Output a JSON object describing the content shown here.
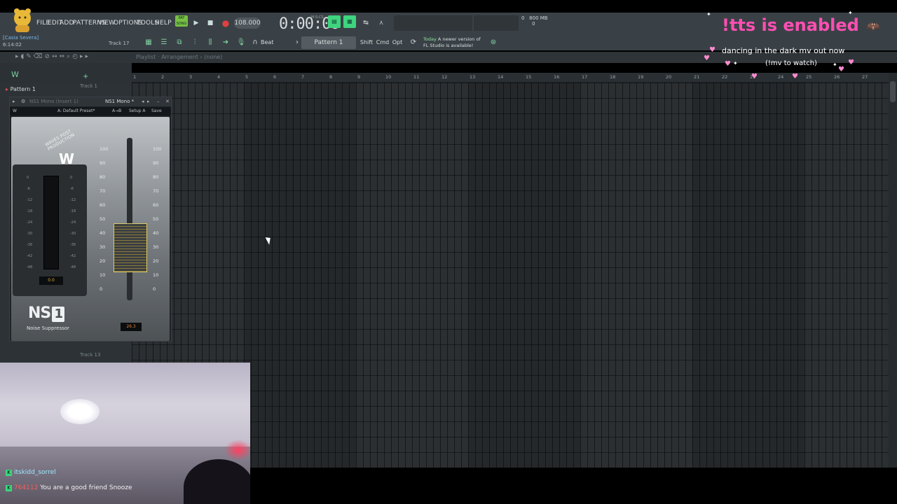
{
  "menu": [
    "FILE",
    "EDIT",
    "ADD",
    "PATTERNS",
    "VIEW",
    "OPTIONS",
    "TOOLS",
    "HELP"
  ],
  "project": {
    "name": "[Casia Severa]",
    "time": "6:14:02",
    "track": "Track 17"
  },
  "transport": {
    "pattern_badge": "PAT SONG",
    "play": "▶",
    "stop": "■",
    "record": "●",
    "tempo": "108.000",
    "time": "0:00:00",
    "time_unit": "M:S:CS"
  },
  "monitor": {
    "cpu": "0",
    "memory": "800 MB",
    "polyphony": "0"
  },
  "toolbar2": {
    "snap": "Beat",
    "pattern": "Pattern 1",
    "keys": [
      "Shift",
      "Cmd",
      "Opt"
    ],
    "news_line1_prefix": "Today",
    "news_line1": "A newer version of",
    "news_line2": "FL Studio is available!"
  },
  "playlist": {
    "title": "Playlist · Arrangement › (none)",
    "pattern_label": "Pattern 1",
    "tracks": [
      "Track 1",
      "Track 13"
    ],
    "bars": [
      "1",
      "2",
      "3",
      "4",
      "5",
      "6",
      "7",
      "8",
      "9",
      "10",
      "11",
      "12",
      "13",
      "14",
      "15",
      "16",
      "17",
      "18",
      "19",
      "20",
      "21",
      "22",
      "23",
      "24",
      "25",
      "26",
      "27"
    ]
  },
  "plugin": {
    "title": "NS1 Mono (Insert 1)",
    "title_right": "NS1 Mono *",
    "preset": "A: Default Preset*",
    "btn_ab": "A→B",
    "btn_setup": "Setup A",
    "btn_save": "Save",
    "brand": "WAVES POST PRODUCTION",
    "product": "NS",
    "product_num": "1",
    "product_sub": "Noise Suppressor",
    "meter_value": "0.0",
    "fader_value": "26.3",
    "meter_scale": [
      "0",
      "-6",
      "-12",
      "-18",
      "-24",
      "-30",
      "-36",
      "-42",
      "-48"
    ],
    "fader_scale": [
      "100",
      "90",
      "80",
      "70",
      "60",
      "50",
      "40",
      "30",
      "20",
      "10",
      "0"
    ]
  },
  "overlay": {
    "title": "!tts is enabled",
    "line1": "dancing in the dark mv out now",
    "line2": "(!mv to watch)"
  },
  "chat": [
    {
      "user": "itskidd_sorrel",
      "message": ""
    },
    {
      "user": "764112",
      "message": "You are a good friend Snooze"
    }
  ],
  "colors": {
    "accent_green": "#3fd47e",
    "overlay_pink": "#ff4fb2",
    "record_red": "#e04040"
  }
}
